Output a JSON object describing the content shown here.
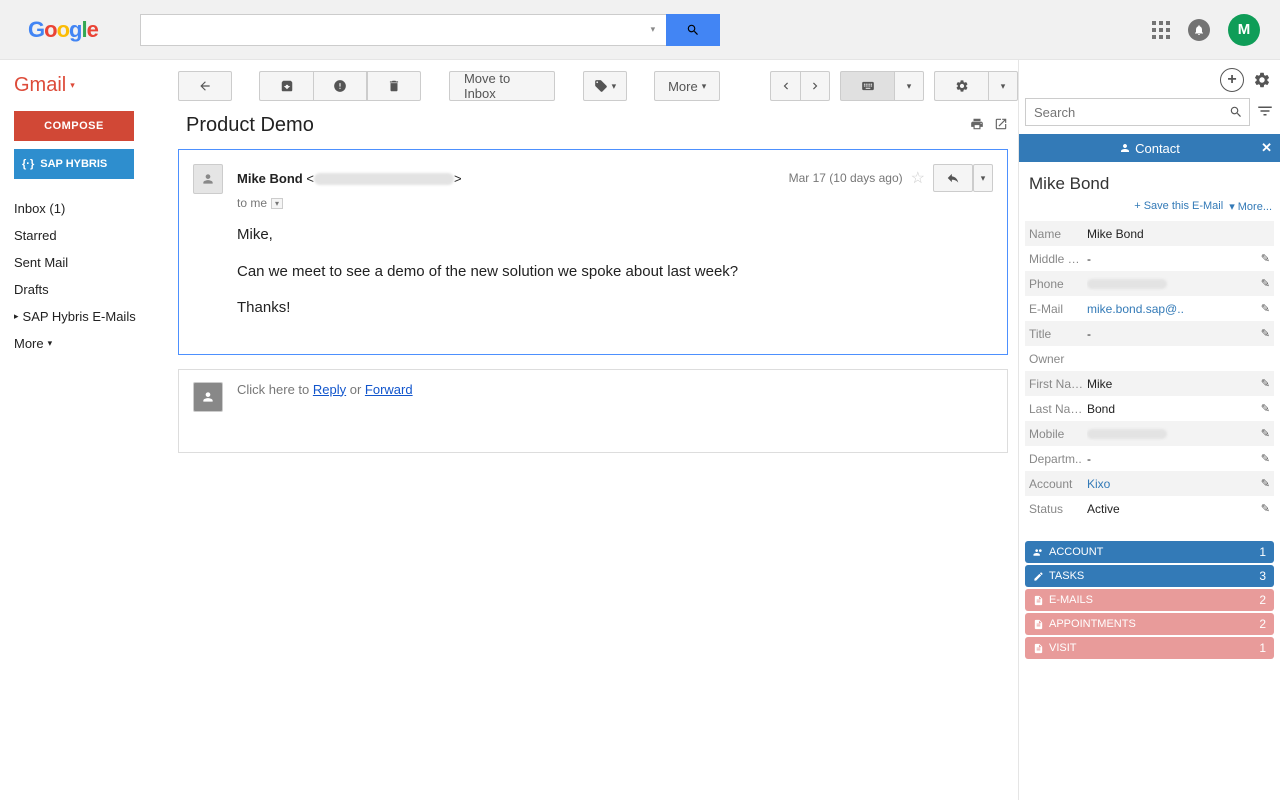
{
  "header": {
    "avatar_initial": "M"
  },
  "sidebar": {
    "gmail_label": "Gmail",
    "compose": "COMPOSE",
    "hybris": "SAP HYBRIS",
    "items": [
      "Inbox (1)",
      "Starred",
      "Sent Mail",
      "Drafts",
      "SAP Hybris E-Mails",
      "More"
    ]
  },
  "toolbar": {
    "move_to_inbox": "Move to Inbox",
    "more": "More"
  },
  "message": {
    "subject": "Product Demo",
    "sender_name": "Mike Bond",
    "date": "Mar 17 (10 days ago)",
    "to": "to me",
    "body_greeting": "Mike,",
    "body_line": "Can we meet to see a demo of the new solution we spoke about last week?",
    "body_thanks": "Thanks!",
    "reply_prefix": "Click here to ",
    "reply_word": "Reply",
    "reply_or": " or ",
    "forward_word": "Forward"
  },
  "panel": {
    "search_placeholder": "Search",
    "contact_header": "Contact",
    "contact_name": "Mike Bond",
    "save_email": "Save this E-Mail",
    "more": "More...",
    "fields": [
      {
        "label": "Name",
        "value": "Mike Bond",
        "edit": false
      },
      {
        "label": "Middle …",
        "value": "-",
        "edit": true
      },
      {
        "label": "Phone",
        "value": "__redacted__",
        "edit": true
      },
      {
        "label": "E-Mail",
        "value": "mike.bond.sap@..",
        "edit": true,
        "link": true
      },
      {
        "label": "Title",
        "value": "-",
        "edit": true
      },
      {
        "label": "Owner",
        "value": "",
        "edit": false
      },
      {
        "label": "First Na…",
        "value": "Mike",
        "edit": true
      },
      {
        "label": "Last Na…",
        "value": "Bond",
        "edit": true
      },
      {
        "label": "Mobile",
        "value": "__redacted__",
        "edit": true
      },
      {
        "label": "Departm..",
        "value": "-",
        "edit": true
      },
      {
        "label": "Account",
        "value": "Kixo",
        "edit": true,
        "link": true
      },
      {
        "label": "Status",
        "value": "Active",
        "edit": true
      }
    ],
    "related": [
      {
        "label": "ACCOUNT",
        "count": "1",
        "style": "blue",
        "icon": "users"
      },
      {
        "label": "TASKS",
        "count": "3",
        "style": "blue",
        "icon": "pencil"
      },
      {
        "label": "E-MAILS",
        "count": "2",
        "style": "pink",
        "icon": "doc"
      },
      {
        "label": "APPOINTMENTS",
        "count": "2",
        "style": "pink",
        "icon": "doc"
      },
      {
        "label": "VISIT",
        "count": "1",
        "style": "pink",
        "icon": "doc"
      }
    ]
  }
}
